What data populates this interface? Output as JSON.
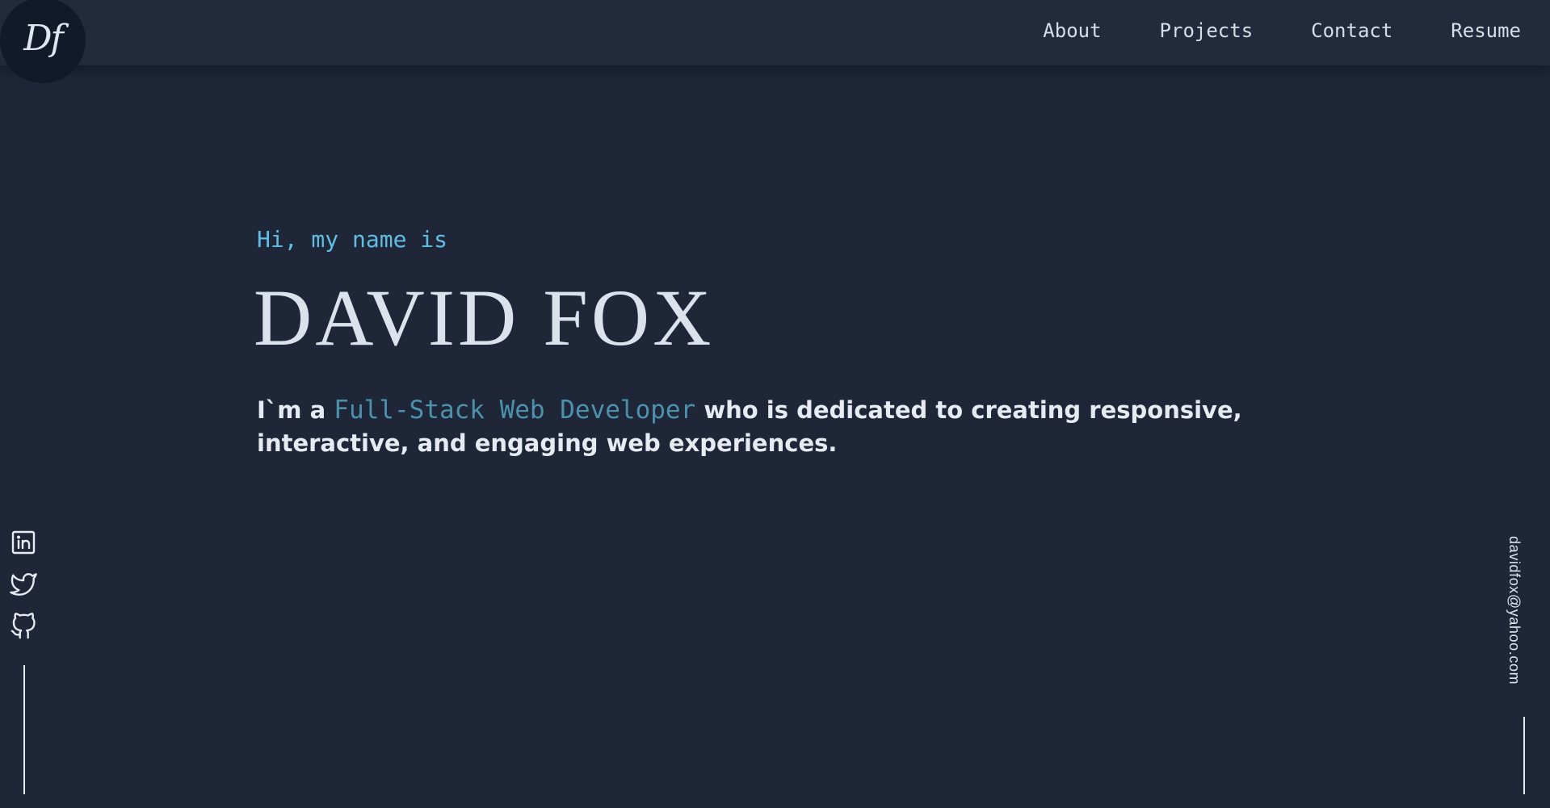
{
  "logo": {
    "text": "Df"
  },
  "nav": {
    "items": [
      {
        "label": "About"
      },
      {
        "label": "Projects"
      },
      {
        "label": "Contact"
      },
      {
        "label": "Resume"
      }
    ]
  },
  "hero": {
    "greeting": "Hi, my name is",
    "name": "DAVID FOX",
    "tagline_prefix": "I`m a",
    "tagline_highlight": "Full-Stack Web Developer",
    "tagline_suffix": "who is dedicated to creating responsive, interactive, and engaging web experiences."
  },
  "socials": [
    {
      "icon": "linkedin-icon"
    },
    {
      "icon": "twitter-icon"
    },
    {
      "icon": "github-icon"
    }
  ],
  "email": "davidfox@yahoo.com",
  "colors": {
    "background": "#1e2638",
    "navbar": "#222b3c",
    "logo_circle": "#121a29",
    "accent": "#62bde2",
    "accent_dark": "#4d92ad",
    "text": "#dbe2ec"
  }
}
